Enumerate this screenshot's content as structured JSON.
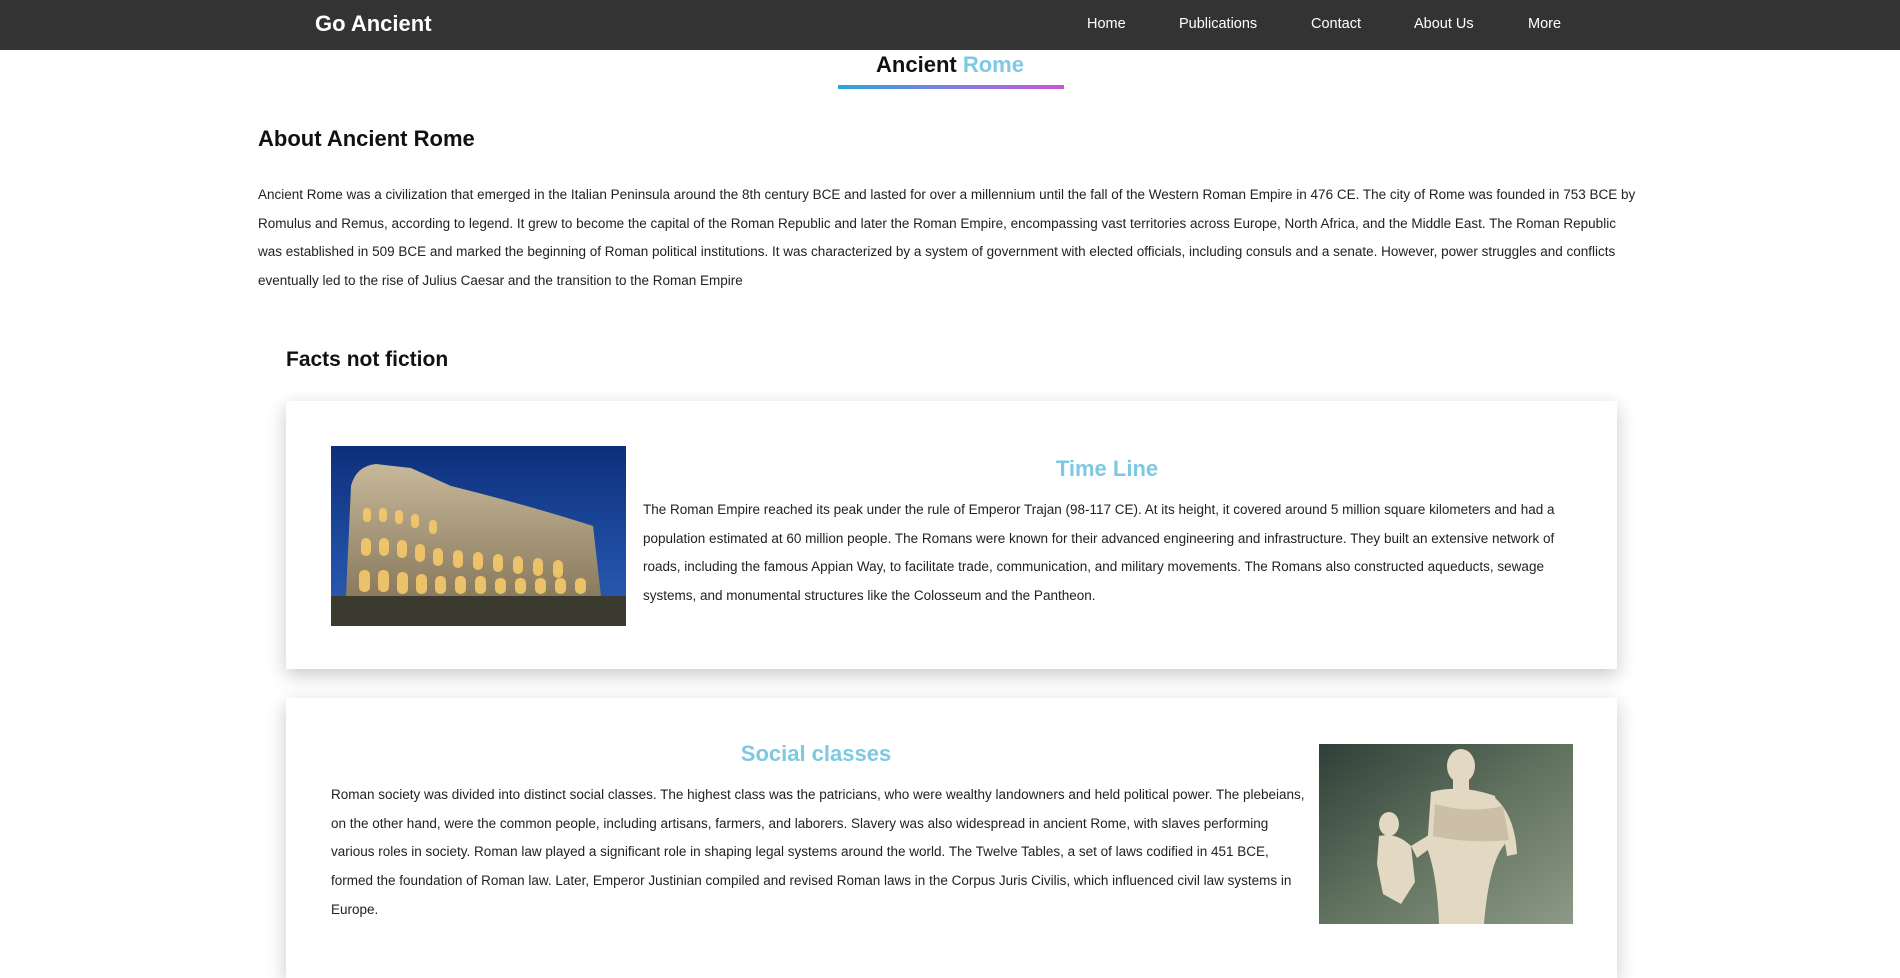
{
  "nav": {
    "brand": "Go Ancient",
    "links": [
      "Home",
      "Publications",
      "Contact",
      "About Us",
      "More"
    ]
  },
  "page_title": {
    "main": "Ancient",
    "accent": "Rome"
  },
  "about": {
    "heading": "About Ancient Rome",
    "text": "Ancient Rome was a civilization that emerged in the Italian Peninsula around the 8th century BCE and lasted for over a millennium until the fall of the Western Roman Empire in 476 CE. The city of Rome was founded in 753 BCE by Romulus and Remus, according to legend. It grew to become the capital of the Roman Republic and later the Roman Empire, encompassing vast territories across Europe, North Africa, and the Middle East. The Roman Republic was established in 509 BCE and marked the beginning of Roman political institutions. It was characterized by a system of government with elected officials, including consuls and a senate. However, power struggles and conflicts eventually led to the rise of Julius Caesar and the transition to the Roman Empire"
  },
  "facts": {
    "heading": "Facts not fiction",
    "cards": [
      {
        "title": "Time Line",
        "text": "The Roman Empire reached its peak under the rule of Emperor Trajan (98-117 CE). At its height, it covered around 5 million square kilometers and had a population estimated at 60 million people. The Romans were known for their advanced engineering and infrastructure. They built an extensive network of roads, including the famous Appian Way, to facilitate trade, communication, and military movements. The Romans also constructed aqueducts, sewage systems, and monumental structures like the Colosseum and the Pantheon.",
        "image": "colosseum-photo"
      },
      {
        "title": "Social classes",
        "text": "Roman society was divided into distinct social classes. The highest class was the patricians, who were wealthy landowners and held political power. The plebeians, on the other hand, were the common people, including artisans, farmers, and laborers. Slavery was also widespread in ancient Rome, with slaves performing various roles in society. Roman law played a significant role in shaping legal systems around the world. The Twelve Tables, a set of laws codified in 451 BCE, formed the foundation of Roman law. Later, Emperor Justinian compiled and revised Roman laws in the Corpus Juris Civilis, which influenced civil law systems in Europe.",
        "image": "roman-statue-photo"
      }
    ]
  },
  "colors": {
    "navbar": "#333333",
    "accent": "#7ec8e3",
    "underline_start": "#2aa7d6",
    "underline_end": "#c956d6"
  }
}
